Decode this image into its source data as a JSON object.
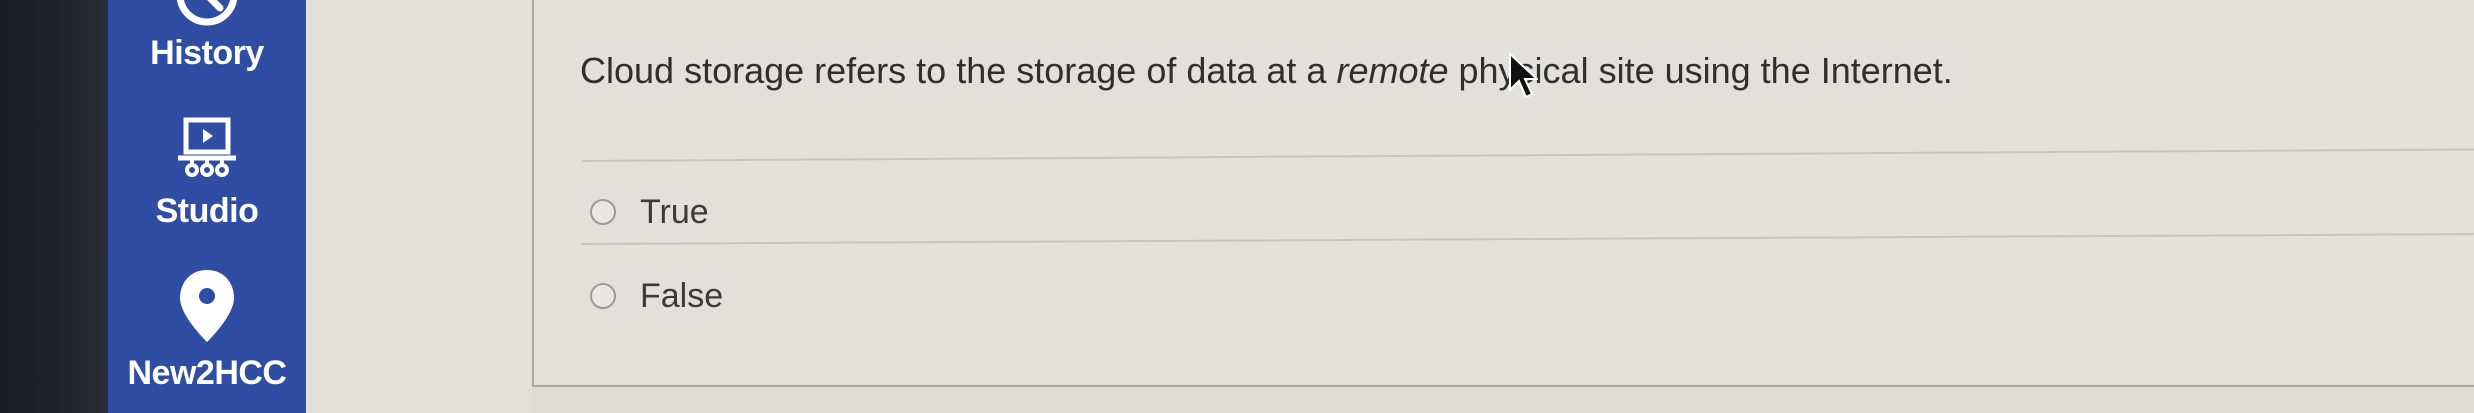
{
  "sidebar": {
    "items": [
      {
        "label": "History",
        "icon": "clock-icon"
      },
      {
        "label": "Studio",
        "icon": "studio-icon"
      },
      {
        "label": "New2HCC",
        "icon": "location-pin-icon"
      }
    ]
  },
  "question": {
    "text_before": "Cloud storage refers to the storage of data at a ",
    "text_emphasis": "remote",
    "text_after": " physical site using the Internet."
  },
  "options": [
    {
      "label": "True",
      "selected": false
    },
    {
      "label": "False",
      "selected": false
    }
  ],
  "colors": {
    "sidebar": "#2f4da3",
    "content_background": "#e2e0db",
    "text": "#2f2f2f"
  }
}
